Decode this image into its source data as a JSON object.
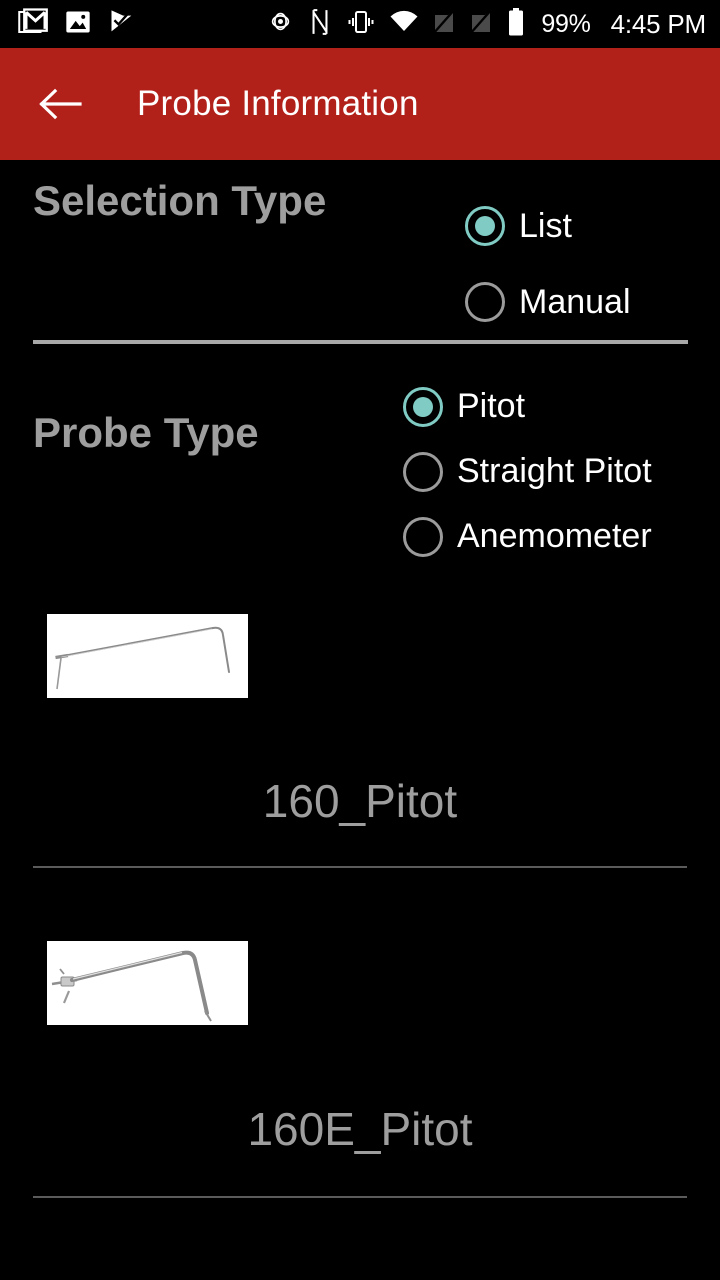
{
  "status_bar": {
    "icons_left": [
      "gmail-icon",
      "photos-icon",
      "checkmark-flag-icon"
    ],
    "icons_right": [
      "location-icon",
      "nfc-icon",
      "vibrate-icon",
      "wifi-icon",
      "no-sim-1-icon",
      "no-sim-2-icon"
    ],
    "battery_percent": "99%",
    "time": "4:45 PM"
  },
  "app_bar": {
    "back_icon": "back-arrow-icon",
    "title": "Probe Information",
    "background_color": "#b2201a"
  },
  "form": {
    "selection_type": {
      "label": "Selection Type",
      "options": [
        {
          "label": "List",
          "selected": true
        },
        {
          "label": "Manual",
          "selected": false
        }
      ]
    },
    "probe_type": {
      "label": "Probe Type",
      "options": [
        {
          "label": "Pitot",
          "selected": true
        },
        {
          "label": "Straight Pitot",
          "selected": false
        },
        {
          "label": "Anemometer",
          "selected": false
        }
      ]
    }
  },
  "probe_list": [
    {
      "name": "160_Pitot",
      "image": "pitot-tube-thin-image"
    },
    {
      "name": "160E_Pitot",
      "image": "pitot-tube-thick-image"
    }
  ],
  "colors": {
    "accent_teal": "#80cbc4",
    "toolbar_red": "#b2201a",
    "background": "#000000",
    "label_gray": "#9e9e9e",
    "divider_gray": "#5b5b5b"
  }
}
